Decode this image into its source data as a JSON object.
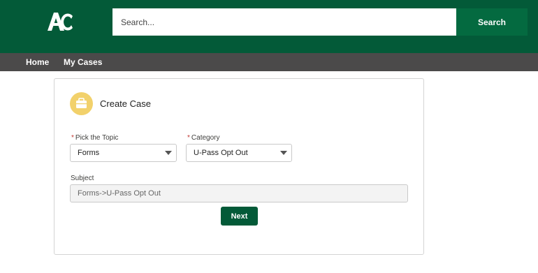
{
  "header": {
    "logo_text": "AC",
    "search_placeholder": "Search...",
    "search_button_label": "Search",
    "colors": {
      "brand": "#035a38",
      "search_button": "#046a40",
      "nav": "#4b4a4a"
    }
  },
  "nav": {
    "items": [
      {
        "label": "Home"
      },
      {
        "label": "My Cases"
      }
    ]
  },
  "case_form": {
    "title": "Create Case",
    "icon": "briefcase-icon",
    "icon_color": "#f2d16b",
    "topic": {
      "label": "Pick the Topic",
      "required_mark": "*",
      "value": "Forms"
    },
    "category": {
      "label": "Category",
      "required_mark": "*",
      "value": "U-Pass Opt Out"
    },
    "subject": {
      "label": "Subject",
      "value": "Forms->U-Pass Opt Out"
    },
    "next_label": "Next"
  }
}
